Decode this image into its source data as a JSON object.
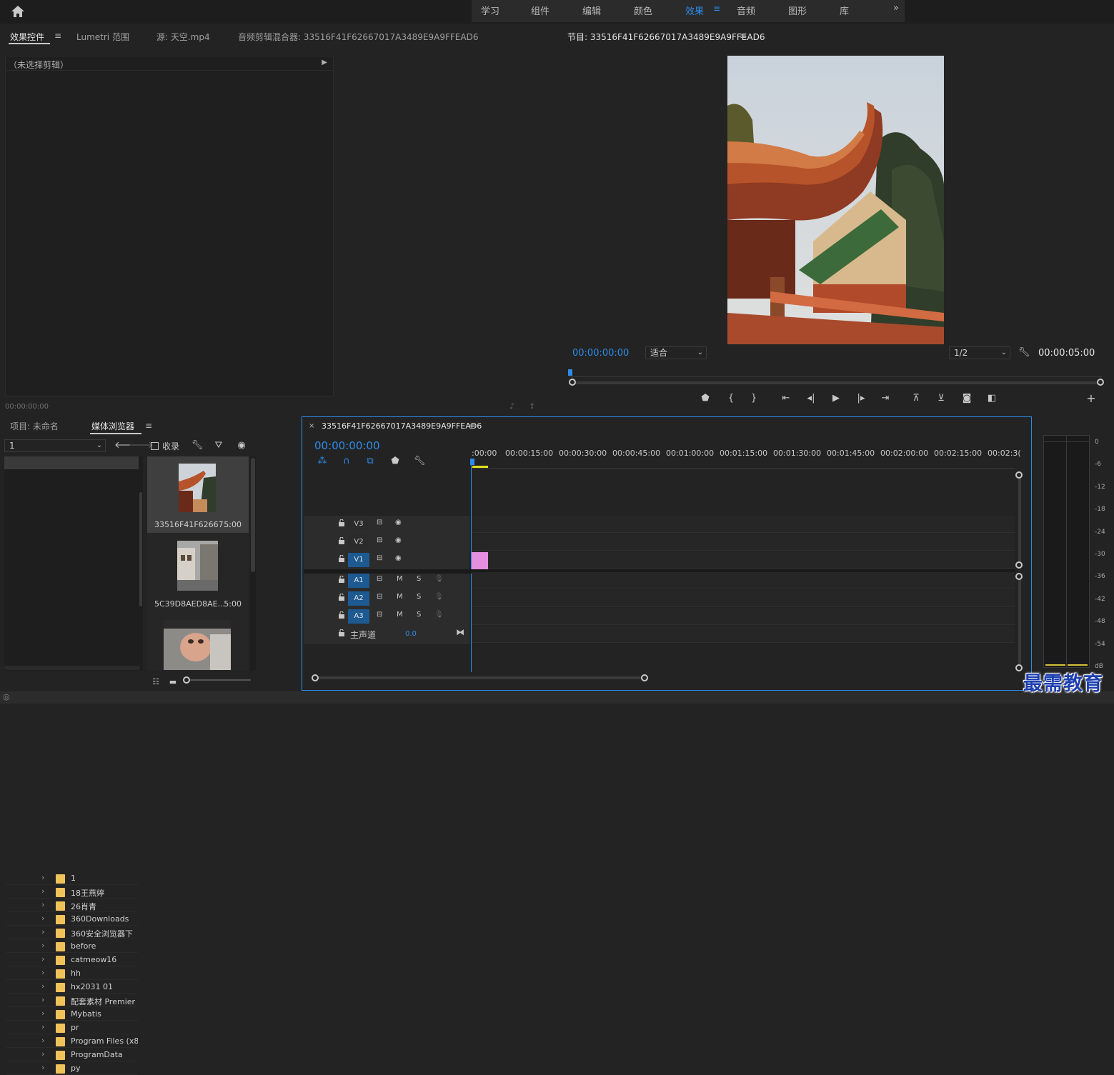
{
  "workspace_tabs": [
    "学习",
    "组件",
    "编辑",
    "颜色",
    "效果",
    "音频",
    "图形",
    "库"
  ],
  "workspace_active": "效果",
  "workspace_more": "»",
  "source_panel": {
    "tabs": [
      "效果控件",
      "Lumetri 范围",
      "源: 天空.mp4",
      "音频剪辑混合器: 33516F41F62667017A3489E9A9FFEAD6"
    ],
    "no_clip": "（未选择剪辑）",
    "timecode": "00:00:00:00"
  },
  "program_panel": {
    "title": "节目: 33516F41F62667017A3489E9A9FFEAD6",
    "timecode": "00:00:00:00",
    "fit": "适合",
    "resolution": "1/2",
    "duration": "00:00:05:00",
    "playhead": 0.0
  },
  "project_panel": {
    "tabs": [
      "项目: 未命名",
      "媒体浏览器"
    ],
    "location": "1",
    "favorites_label": "收录",
    "folders": [
      "1",
      "18王燕婷",
      "26肖青",
      "360Downloads",
      "360安全浏览器下",
      "before",
      "catmeow16",
      "hh",
      "hx2031 01",
      "配套素材 Premier",
      "Mybatis",
      "pr",
      "Program Files (x86",
      "ProgramData",
      "py"
    ],
    "thumbnails": [
      {
        "name": "33516F41F62667...",
        "duration": "5:00"
      },
      {
        "name": "5C39D8AED8AE...",
        "duration": "5:00"
      },
      {
        "name": "",
        "duration": ""
      }
    ]
  },
  "timeline": {
    "sequence_name": "33516F41F62667017A3489E9A9FFEAD6",
    "timecode": "00:00:00:00",
    "ruler": [
      ":00:00",
      "00:00:15:00",
      "00:00:30:00",
      "00:00:45:00",
      "00:01:00:00",
      "00:01:15:00",
      "00:01:30:00",
      "00:01:45:00",
      "00:02:00:00",
      "00:02:15:00",
      "00:02:3("
    ],
    "video_tracks": [
      "V3",
      "V2",
      "V1"
    ],
    "audio_tracks": [
      "A1",
      "A2",
      "A3"
    ],
    "audio_m": "M",
    "audio_s": "S",
    "master_label": "主声道",
    "master_value": "0.0"
  },
  "meter": {
    "labels": [
      "0",
      "-6",
      "-12",
      "-18",
      "-24",
      "-30",
      "-36",
      "-42",
      "-48",
      "-54",
      "dB"
    ]
  },
  "watermark": "最需教育",
  "colors": {
    "accent": "#2d8ceb",
    "clip": "#e48fe0",
    "track_selected": "#1d5a92"
  }
}
